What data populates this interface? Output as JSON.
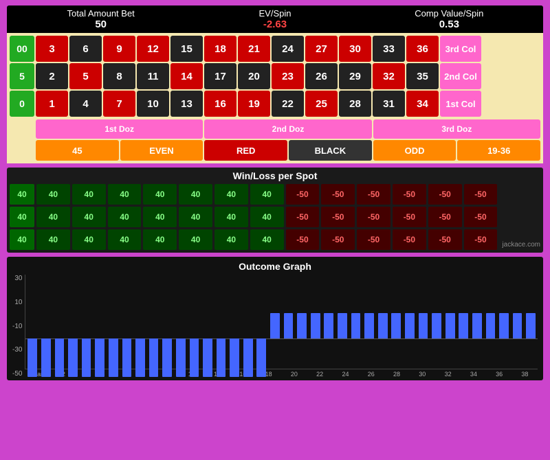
{
  "stats": {
    "total_bet_label": "Total Amount Bet",
    "total_bet_value": "50",
    "ev_label": "EV/Spin",
    "ev_value": "-2.63",
    "comp_label": "Comp Value/Spin",
    "comp_value": "0.53"
  },
  "roulette": {
    "rows": [
      {
        "zero": "00",
        "numbers": [
          3,
          6,
          9,
          12,
          15,
          18,
          21,
          24,
          27,
          30,
          33,
          36
        ],
        "colors": [
          "red",
          "black",
          "red",
          "red",
          "black",
          "red",
          "red",
          "black",
          "red",
          "red",
          "black",
          "red"
        ],
        "col_label": "3rd Col"
      },
      {
        "zero": "5",
        "numbers": [
          2,
          5,
          8,
          11,
          14,
          17,
          20,
          23,
          26,
          29,
          32,
          35
        ],
        "colors": [
          "black",
          "red",
          "black",
          "black",
          "red",
          "black",
          "black",
          "red",
          "black",
          "black",
          "red",
          "black"
        ],
        "col_label": "2nd Col"
      },
      {
        "zero": "0",
        "numbers": [
          1,
          4,
          7,
          10,
          13,
          16,
          19,
          22,
          25,
          28,
          31,
          34
        ],
        "colors": [
          "red",
          "black",
          "red",
          "black",
          "black",
          "red",
          "red",
          "black",
          "red",
          "black",
          "black",
          "red"
        ],
        "col_label": "1st Col"
      }
    ],
    "dozens": [
      "1st Doz",
      "2nd Doz",
      "3rd Doz"
    ],
    "outside_bets": [
      {
        "label": "45",
        "type": "orange"
      },
      {
        "label": "EVEN",
        "type": "orange"
      },
      {
        "label": "RED",
        "type": "red"
      },
      {
        "label": "BLACK",
        "type": "black"
      },
      {
        "label": "ODD",
        "type": "orange"
      },
      {
        "label": "19-36",
        "type": "orange"
      }
    ]
  },
  "winloss": {
    "title": "Win/Loss per Spot",
    "zeros": [
      "40",
      "40",
      "40"
    ],
    "rows": [
      [
        "40",
        "40",
        "40",
        "40",
        "40",
        "40",
        "40",
        "-50",
        "-50",
        "-50",
        "-50",
        "-50",
        "-50"
      ],
      [
        "40",
        "40",
        "40",
        "40",
        "40",
        "40",
        "40",
        "-50",
        "-50",
        "-50",
        "-50",
        "-50",
        "-50"
      ],
      [
        "40",
        "40",
        "40",
        "40",
        "40",
        "40",
        "40",
        "-50",
        "-50",
        "-50",
        "-50",
        "-50",
        "-50"
      ]
    ],
    "watermark": "jackace.com"
  },
  "graph": {
    "title": "Outcome Graph",
    "y_labels": [
      "30",
      "10",
      "-10",
      "-30",
      "-50"
    ],
    "x_labels": [
      "Start",
      "2",
      "4",
      "6",
      "8",
      "10",
      "12",
      "14",
      "16",
      "18",
      "20",
      "22",
      "24",
      "26",
      "28",
      "30",
      "32",
      "34",
      "36",
      "38"
    ],
    "bars": [
      -30,
      -30,
      -30,
      -30,
      -30,
      -30,
      -30,
      -30,
      -30,
      -30,
      -30,
      -30,
      -30,
      -30,
      -30,
      -30,
      -30,
      -30,
      20,
      20,
      20,
      20,
      20,
      20,
      20,
      20,
      20,
      20,
      20,
      20,
      20,
      20,
      20,
      20,
      20,
      20,
      20,
      20
    ],
    "zero_percent": 62
  }
}
